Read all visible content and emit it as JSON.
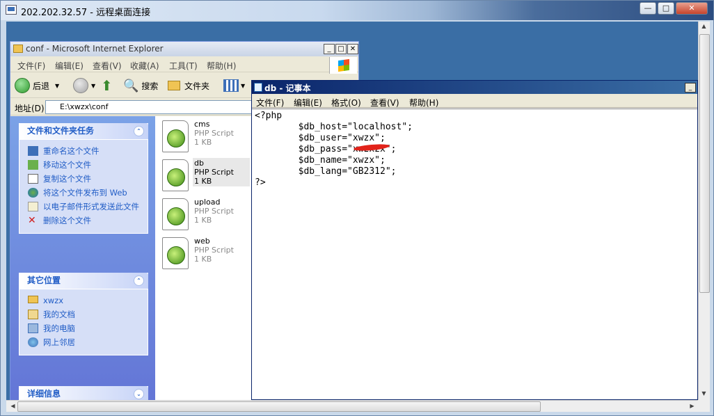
{
  "rdp": {
    "title": "202.202.32.57 - 远程桌面连接",
    "min_label": "—",
    "max_label": "□",
    "close_label": "✕"
  },
  "ie": {
    "title": "conf - Microsoft Internet Explorer",
    "menu": [
      "文件(F)",
      "编辑(E)",
      "查看(V)",
      "收藏(A)",
      "工具(T)",
      "帮助(H)"
    ],
    "toolbar": {
      "back": "后退",
      "search": "搜索",
      "folders": "文件夹"
    },
    "address_label": "地址(D)",
    "address_value": "E:\\xwzx\\conf",
    "tasks_panel": {
      "title": "文件和文件夹任务",
      "items": [
        "重命名这个文件",
        "移动这个文件",
        "复制这个文件",
        "将这个文件发布到 Web",
        "以电子邮件形式发送此文件",
        "删除这个文件"
      ]
    },
    "places_panel": {
      "title": "其它位置",
      "items": [
        "xwzx",
        "我的文档",
        "我的电脑",
        "网上邻居"
      ]
    },
    "details_panel": {
      "title": "详细信息"
    },
    "files": [
      {
        "name": "cms",
        "type": "PHP Script",
        "size": "1 KB"
      },
      {
        "name": "db",
        "type": "PHP Script",
        "size": "1 KB"
      },
      {
        "name": "upload",
        "type": "PHP Script",
        "size": "1 KB"
      },
      {
        "name": "web",
        "type": "PHP Script",
        "size": "1 KB"
      }
    ]
  },
  "notepad": {
    "title": "db - 记事本",
    "menu": [
      "文件(F)",
      "编辑(E)",
      "格式(O)",
      "查看(V)",
      "帮助(H)"
    ],
    "content": "<?php\n        $db_host=\"localhost\";\n        $db_user=\"xwzx\";\n        $db_pass=\"xwzxzx\";\n        $db_name=\"xwzx\";\n        $db_lang=\"GB2312\";\n?>"
  }
}
